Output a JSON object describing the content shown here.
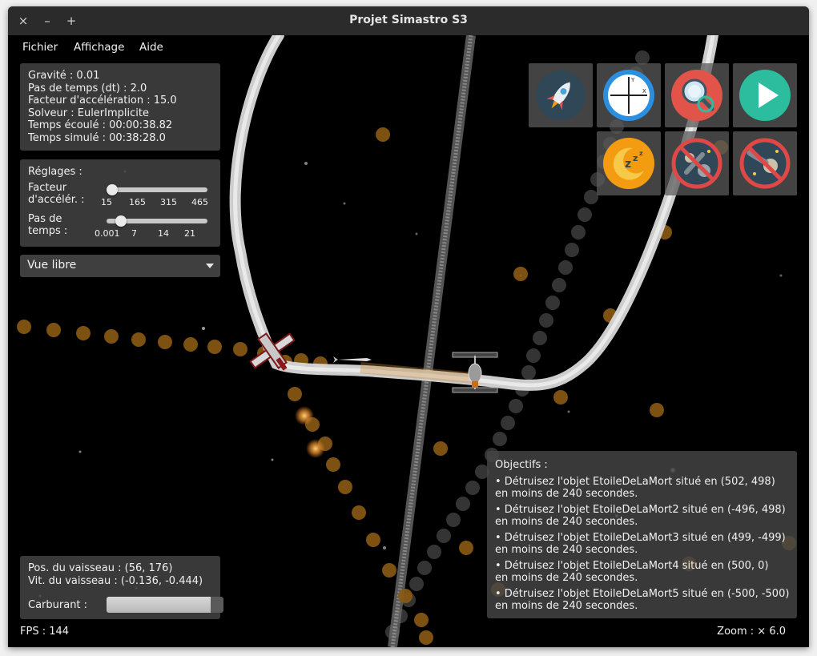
{
  "window": {
    "title": "Projet Simastro S3",
    "buttons": [
      "×",
      "–",
      "+"
    ]
  },
  "menu": {
    "items": [
      "Fichier",
      "Affichage",
      "Aide"
    ]
  },
  "info": {
    "lines": [
      "Gravité : 0.01",
      "Pas de temps (dt) : 2.0",
      "Facteur d'accélération : 15.0",
      "Solveur : EulerImplicite",
      "Temps écoulé : 00:00:38.82",
      "Temps simulé : 00:38:28.0"
    ]
  },
  "settings": {
    "title": "Réglages :",
    "accel": {
      "label_line1": "Facteur",
      "label_line2": "d'accélér. :",
      "ticks": [
        "15",
        "165",
        "315",
        "465"
      ],
      "value_fraction": 0.0
    },
    "timestep": {
      "label_line1": "Pas de",
      "label_line2": "temps :",
      "ticks": [
        "0.001",
        "7",
        "14",
        "21"
      ],
      "value_fraction": 0.1
    }
  },
  "view_select": {
    "value": "Vue libre"
  },
  "toolbar": {
    "tools": [
      {
        "icon": "rocket-icon"
      },
      {
        "icon": "axes-icon"
      },
      {
        "icon": "magnifier-icon"
      },
      {
        "icon": "play-icon"
      },
      {
        "icon": "sleep-moon-icon"
      },
      {
        "icon": "no-asteroid-icon"
      },
      {
        "icon": "no-comet-icon"
      }
    ]
  },
  "objectives": {
    "title": "Objectifs :",
    "items": [
      {
        "line1": "• Détruisez l'objet EtoileDeLaMort situé en (502, 498)",
        "line2": "en moins de 240 secondes."
      },
      {
        "line1": "• Détruisez l'objet EtoileDeLaMort2 situé en (-496, 498)",
        "line2": "en moins de 240 secondes."
      },
      {
        "line1": "• Détruisez l'objet EtoileDeLaMort3 situé en (499, -499)",
        "line2": "en moins de 240 secondes."
      },
      {
        "line1": "• Détruisez l'objet EtoileDeLaMort4 situé en (500, 0)",
        "line2": "en moins de 240 secondes."
      },
      {
        "line1": "• Détruisez l'objet EtoileDeLaMort5 situé en (-500, -500)",
        "line2": "en moins de 240 secondes."
      }
    ]
  },
  "ship": {
    "position": "Pos. du vaisseau : (56, 176)",
    "velocity": "Vit. du vaisseau : (-0.136, -0.444)",
    "fuel_label": "Carburant :",
    "fuel_fraction": 0.89
  },
  "status": {
    "fps": "FPS : 144",
    "zoom": "Zoom : × 6.0"
  },
  "colors": {
    "window_bg": "#000000",
    "panel_bg": "#464646",
    "trail_orange": "#c8781e",
    "trail_white": "#dcdcdc",
    "play_green": "#2bbd9e",
    "axes_blue": "#2b8fe0",
    "magnifier_red": "#e2544a",
    "moon_orange": "#f39c12",
    "forbid_red": "#e04848",
    "rocket_bg": "#2f4757"
  }
}
